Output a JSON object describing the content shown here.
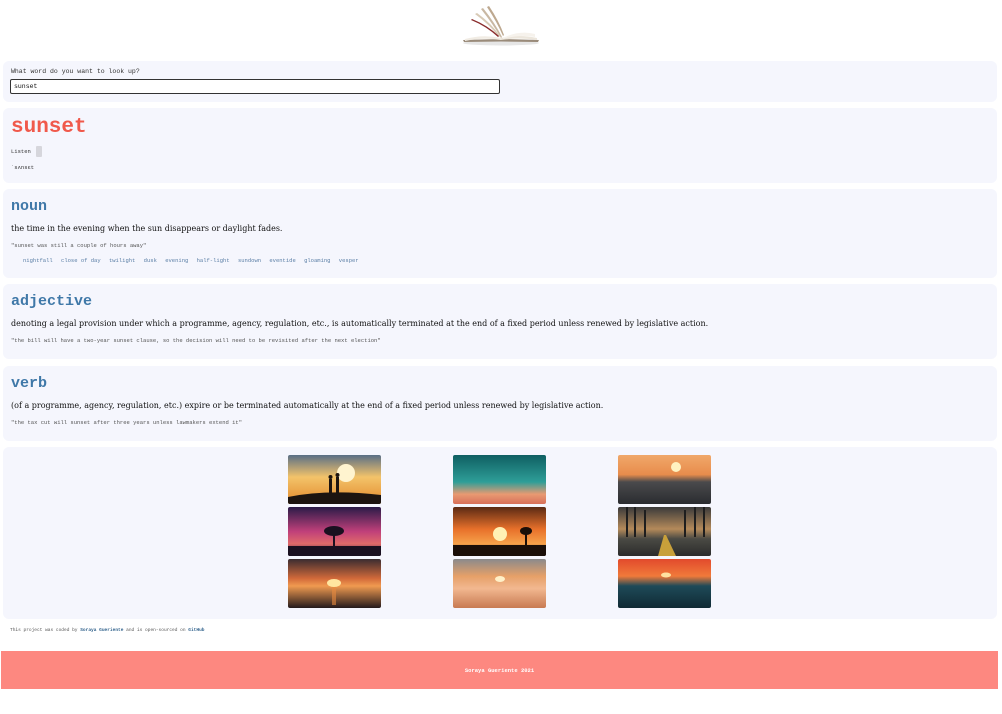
{
  "search": {
    "label": "What word do you want to look up?",
    "value": "sunset"
  },
  "word": {
    "title": "sunset",
    "listen_label": "Listen",
    "phonetic": "ˈsʌnsɛt"
  },
  "meanings": [
    {
      "part_of_speech": "noun",
      "definition": "the time in the evening when the sun disappears or daylight fades.",
      "example": "\"sunset was still a couple of hours away\"",
      "synonyms": [
        "nightfall",
        "close of day",
        "twilight",
        "dusk",
        "evening",
        "half-light",
        "sundown",
        "eventide",
        "gloaming",
        "vesper"
      ]
    },
    {
      "part_of_speech": "adjective",
      "definition": "denoting a legal provision under which a programme, agency, regulation, etc., is automatically terminated at the end of a fixed period unless renewed by legislative action.",
      "example": "\"the bill will have a two-year sunset clause, so the decision will need to be revisited after the next election\""
    },
    {
      "part_of_speech": "verb",
      "definition": "(of a programme, agency, regulation, etc.) expire or be terminated automatically at the end of a fixed period unless renewed by legislative action.",
      "example": "\"the tax cut will sunset after three years unless lawmakers extend it\""
    }
  ],
  "photos": [
    {
      "name": "sunset-photo-silhouettes"
    },
    {
      "name": "sunset-photo-teal-sky"
    },
    {
      "name": "sunset-photo-ocean-waves"
    },
    {
      "name": "sunset-photo-purple-tree"
    },
    {
      "name": "sunset-photo-orange-tree"
    },
    {
      "name": "sunset-photo-forest-road"
    },
    {
      "name": "sunset-photo-sea-horizon"
    },
    {
      "name": "sunset-photo-blurred-beach"
    },
    {
      "name": "sunset-photo-red-sea"
    }
  ],
  "credit": {
    "prefix": "This project was coded by",
    "author": "Soraya Gueriente",
    "middle": "and is open-sourced on",
    "repo_link": "GitHub"
  },
  "footer": {
    "text": "Soraya Gueriente 2021"
  }
}
